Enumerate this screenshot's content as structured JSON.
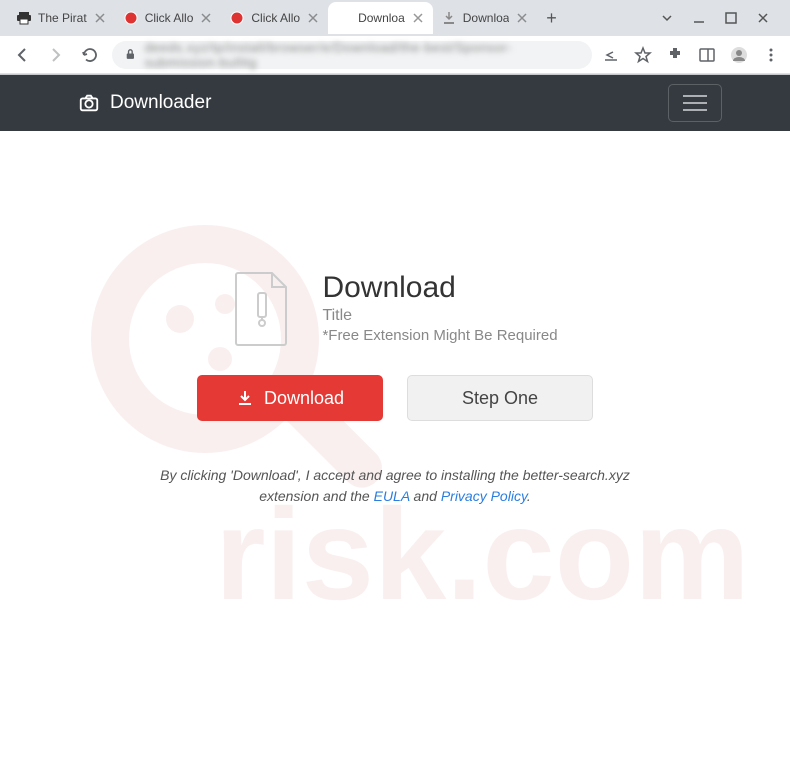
{
  "browser": {
    "tabs": [
      {
        "title": "The Pirat",
        "icon": "printer"
      },
      {
        "title": "Click Allo",
        "icon": "red-dot"
      },
      {
        "title": "Click Allo",
        "icon": "red-dot"
      },
      {
        "title": "Downloa",
        "icon": "blank",
        "active": true
      },
      {
        "title": "Downloa",
        "icon": "download"
      }
    ],
    "url_blurred": "deeds.xyz/tp/install/browser/e/Download/the-best/Sponsor-submission-bullitg"
  },
  "navbar": {
    "brand": "Downloader"
  },
  "hero": {
    "heading": "Download",
    "subtitle": "Title",
    "note": "*Free Extension Might Be Required"
  },
  "buttons": {
    "download": "Download",
    "step_one": "Step One"
  },
  "disclaimer": {
    "text_1": "By clicking 'Download', I accept and agree to installing the better-search.xyz extension and the ",
    "eula": "EULA",
    "and": " and ",
    "privacy": "Privacy Policy",
    "period": "."
  },
  "watermark": {
    "text": "risk.com"
  }
}
